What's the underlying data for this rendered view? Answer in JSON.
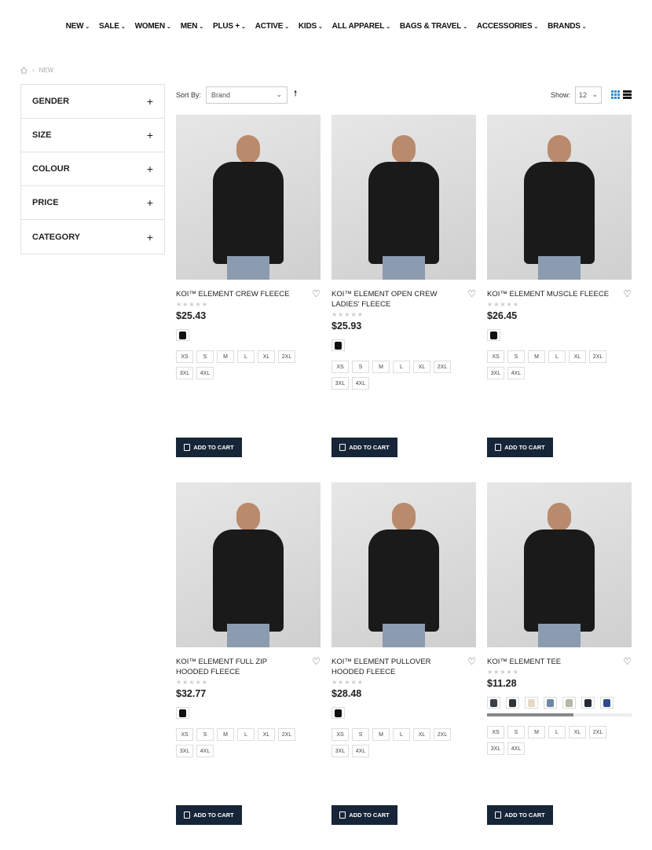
{
  "nav": [
    "NEW",
    "SALE",
    "WOMEN",
    "MEN",
    "PLUS +",
    "ACTIVE",
    "KIDS",
    "ALL APPAREL",
    "BAGS & TRAVEL",
    "ACCESSORIES",
    "BRANDS"
  ],
  "breadcrumb": {
    "current": "NEW"
  },
  "filters": [
    "GENDER",
    "SIZE",
    "COLOUR",
    "PRICE",
    "CATEGORY"
  ],
  "toolbar": {
    "sort_label": "Sort By:",
    "sort_value": "Brand",
    "show_label": "Show:",
    "show_value": "12"
  },
  "products": [
    {
      "title": "KOI™ ELEMENT CREW FLEECE",
      "price": "$25.43",
      "swatches": [
        "#111111"
      ],
      "sizes": [
        "XS",
        "S",
        "M",
        "L",
        "XL",
        "2XL",
        "3XL",
        "4XL"
      ],
      "cart": "ADD TO CART"
    },
    {
      "title": "KOI™ ELEMENT OPEN CREW LADIES' FLEECE",
      "price": "$25.93",
      "swatches": [
        "#111111"
      ],
      "sizes": [
        "XS",
        "S",
        "M",
        "L",
        "XL",
        "2XL",
        "3XL",
        "4XL"
      ],
      "cart": "ADD TO CART"
    },
    {
      "title": "KOI™ ELEMENT MUSCLE FLEECE",
      "price": "$26.45",
      "swatches": [
        "#111111"
      ],
      "sizes": [
        "XS",
        "S",
        "M",
        "L",
        "XL",
        "2XL",
        "3XL",
        "4XL"
      ],
      "cart": "ADD TO CART"
    },
    {
      "title": "KOI™ ELEMENT FULL ZIP HOODED FLEECE",
      "price": "$32.77",
      "swatches": [
        "#111111"
      ],
      "sizes": [
        "XS",
        "S",
        "M",
        "L",
        "XL",
        "2XL",
        "3XL",
        "4XL"
      ],
      "cart": "ADD TO CART"
    },
    {
      "title": "KOI™ ELEMENT PULLOVER HOODED FLEECE",
      "price": "$28.48",
      "swatches": [
        "#111111"
      ],
      "sizes": [
        "XS",
        "S",
        "M",
        "L",
        "XL",
        "2XL",
        "3XL",
        "4XL"
      ],
      "cart": "ADD TO CART"
    },
    {
      "title": "KOI™ ELEMENT TEE",
      "price": "$11.28",
      "swatches": [
        "#3a3f4a",
        "#2f3438",
        "#e8d8c4",
        "#6f88a6",
        "#b4b7a8",
        "#242a35",
        "#2e4c86"
      ],
      "sizes": [
        "XS",
        "S",
        "M",
        "L",
        "XL",
        "2XL",
        "3XL",
        "4XL"
      ],
      "cart": "ADD TO CART"
    }
  ]
}
